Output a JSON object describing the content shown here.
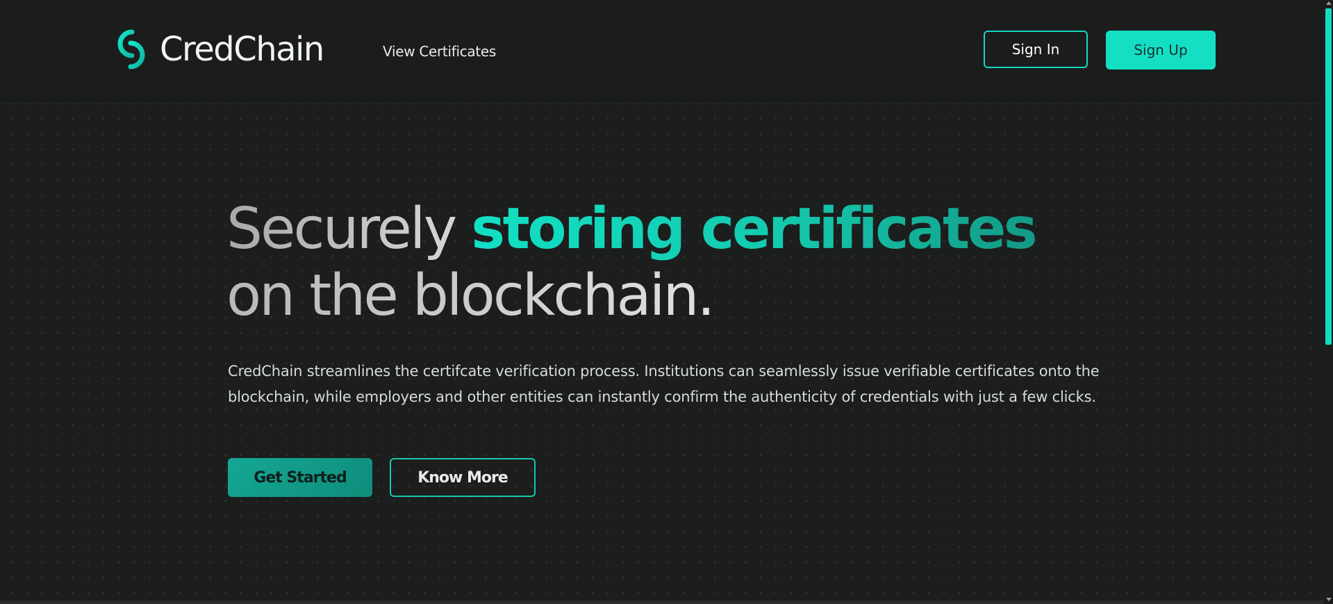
{
  "header": {
    "brand": "CredChain",
    "nav": [
      "View Certificates"
    ],
    "sign_in_label": "Sign In",
    "sign_up_label": "Sign Up"
  },
  "hero": {
    "title_part1": "Securely ",
    "title_accent": "storing certificates",
    "title_line2": "on the blockchain.",
    "description": "CredChain streamlines the certifcate verification process. Institutions can seamlessly issue verifiable certificates onto the blockchain, while employers and other entities can instantly confirm the authenticity of credentials with just a few clicks.",
    "primary_cta": "Get Started",
    "secondary_cta": "Know More"
  },
  "colors": {
    "accent": "#14dfc5",
    "background": "#1c1d1d",
    "text": "#d9dcdc"
  },
  "icons": {
    "logo": "chain-link-icon"
  }
}
